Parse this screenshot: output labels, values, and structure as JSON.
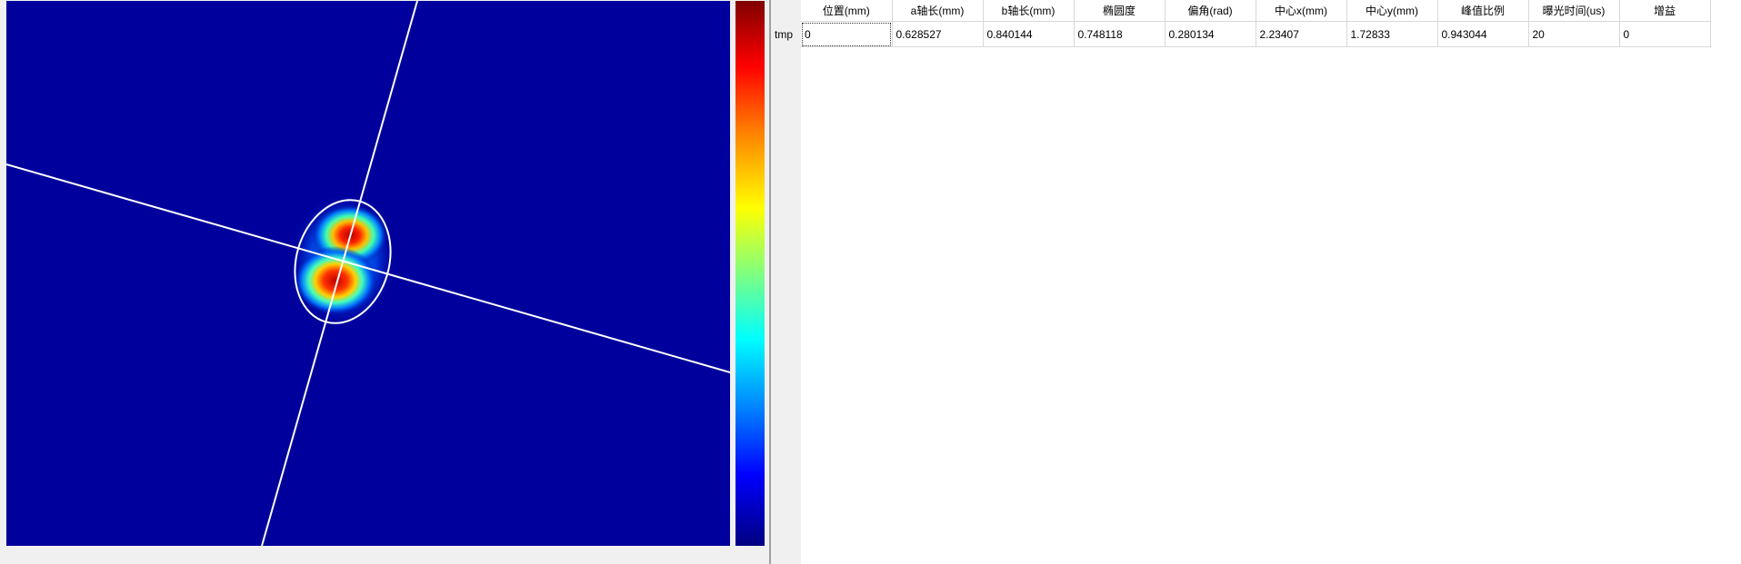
{
  "table": {
    "columns": [
      "位置(mm)",
      "a轴长(mm)",
      "b轴长(mm)",
      "椭圆度",
      "偏角(rad)",
      "中心x(mm)",
      "中心y(mm)",
      "峰值比例",
      "曝光时间(us)",
      "增益"
    ],
    "rows": [
      {
        "label": "tmp",
        "cells": [
          "0",
          "0.628527",
          "0.840144",
          "0.748118",
          "0.280134",
          "2.23407",
          "1.72833",
          "0.943044",
          "20",
          "0"
        ]
      }
    ]
  },
  "colors": {
    "background_field": "#00009c",
    "overlay_lines": "#ffffff",
    "colorbar_top": "#800000",
    "colorbar_bottom": "#000080"
  }
}
